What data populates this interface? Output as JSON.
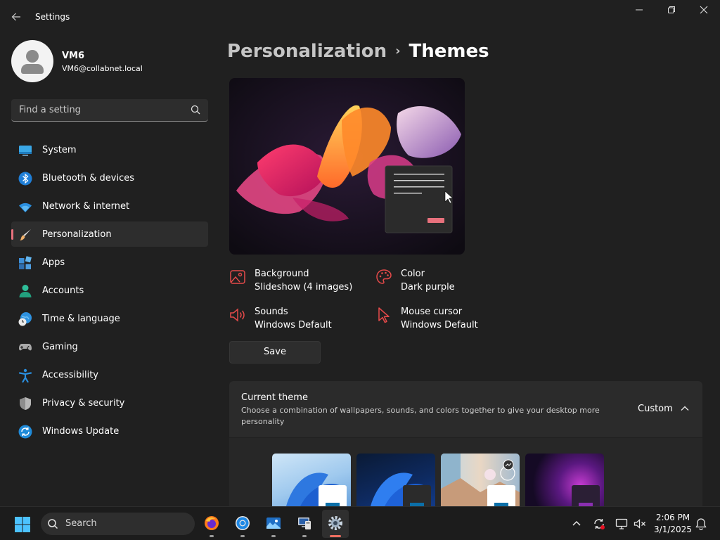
{
  "window": {
    "title": "Settings"
  },
  "user": {
    "name": "VM6",
    "email": "VM6@collabnet.local"
  },
  "search": {
    "placeholder": "Find a setting"
  },
  "nav": {
    "items": [
      {
        "label": "System",
        "icon": "monitor-icon"
      },
      {
        "label": "Bluetooth & devices",
        "icon": "bluetooth-icon"
      },
      {
        "label": "Network & internet",
        "icon": "wifi-icon"
      },
      {
        "label": "Personalization",
        "icon": "brush-icon",
        "active": true
      },
      {
        "label": "Apps",
        "icon": "apps-icon"
      },
      {
        "label": "Accounts",
        "icon": "person-icon"
      },
      {
        "label": "Time & language",
        "icon": "globe-clock-icon"
      },
      {
        "label": "Gaming",
        "icon": "gamepad-icon"
      },
      {
        "label": "Accessibility",
        "icon": "accessibility-icon"
      },
      {
        "label": "Privacy & security",
        "icon": "shield-icon"
      },
      {
        "label": "Windows Update",
        "icon": "update-icon"
      }
    ]
  },
  "breadcrumb": {
    "parent": "Personalization",
    "separator": "›",
    "current": "Themes"
  },
  "theme": {
    "background": {
      "label": "Background",
      "value": "Slideshow (4 images)"
    },
    "color": {
      "label": "Color",
      "value": "Dark purple"
    },
    "sounds": {
      "label": "Sounds",
      "value": "Windows Default"
    },
    "cursor": {
      "label": "Mouse cursor",
      "value": "Windows Default"
    },
    "save_label": "Save"
  },
  "current_theme": {
    "title": "Current theme",
    "subtitle": "Choose a combination of wallpapers, sounds, and colors together to give your desktop more personality",
    "value": "Custom"
  },
  "taskbar": {
    "search_label": "Search",
    "time": "2:06 PM",
    "date": "3/1/2025"
  },
  "colors": {
    "accent": "#e8717d",
    "icon_accent": "#e64a4a",
    "background": "#202020"
  }
}
